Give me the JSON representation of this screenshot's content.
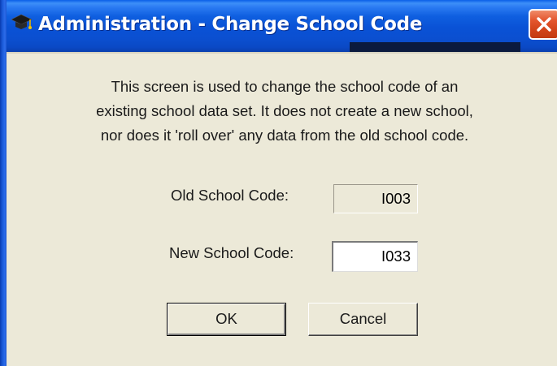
{
  "window": {
    "title": "Administration - Change School Code",
    "title_icon": "graduation-cap-icon",
    "close_icon": "close-icon",
    "colors": {
      "titlebar": "#0a52d6",
      "close_button": "#d24319",
      "background": "#ece9d8"
    }
  },
  "description": {
    "line1": "This screen is used to change the school code of an",
    "line2": "existing school data set. It does not create a new school,",
    "line3": "nor does it 'roll over' any data from the old school code."
  },
  "old_code": {
    "label": "Old School Code:",
    "value": "I003"
  },
  "new_code": {
    "label": "New School Code:",
    "value": "I033"
  },
  "buttons": {
    "ok_label": "OK",
    "cancel_label": "Cancel"
  }
}
